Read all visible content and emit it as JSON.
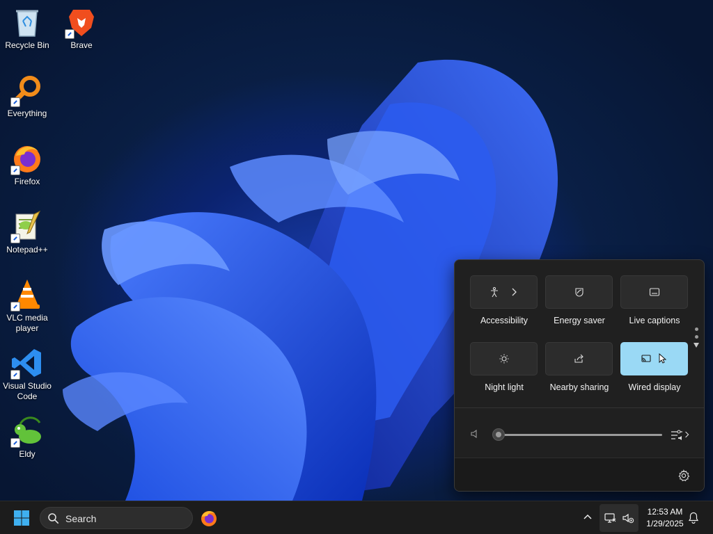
{
  "desktop": {
    "icons": [
      {
        "label": "Recycle Bin",
        "icon": "recycle-bin-icon"
      },
      {
        "label": "Brave",
        "icon": "brave-icon"
      },
      {
        "label": "Everything",
        "icon": "everything-search-icon"
      },
      {
        "label": "Firefox",
        "icon": "firefox-icon"
      },
      {
        "label": "Notepad++",
        "icon": "notepadpp-icon"
      },
      {
        "label": "VLC media player",
        "icon": "vlc-icon"
      },
      {
        "label": "Visual Studio Code",
        "icon": "vscode-icon"
      },
      {
        "label": "Eldy",
        "icon": "eldy-icon"
      }
    ]
  },
  "quick_settings": {
    "tiles": [
      {
        "label": "Accessibility",
        "icon": "accessibility-icon",
        "active": false
      },
      {
        "label": "Energy saver",
        "icon": "energy-saver-icon",
        "active": false
      },
      {
        "label": "Live captions",
        "icon": "live-captions-icon",
        "active": false
      },
      {
        "label": "Night light",
        "icon": "night-light-icon",
        "active": false
      },
      {
        "label": "Nearby sharing",
        "icon": "nearby-sharing-icon",
        "active": false
      },
      {
        "label": "Wired display",
        "icon": "cast-icon",
        "active": true
      }
    ],
    "volume_level": 0,
    "accent_color": "#9ad9f5"
  },
  "taskbar": {
    "search_placeholder": "Search",
    "time": "12:53 AM",
    "date": "1/29/2025"
  }
}
